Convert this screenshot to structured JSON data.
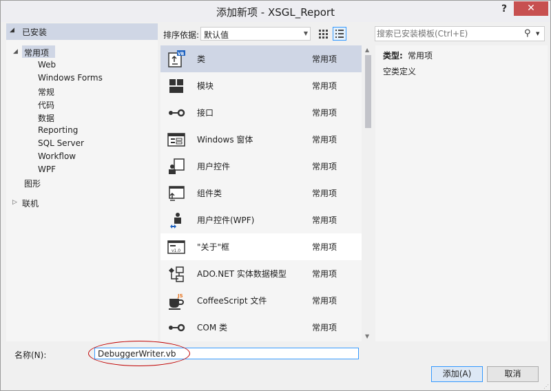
{
  "window": {
    "title": "添加新项 - XSGL_Report",
    "help": "?",
    "close": "✕"
  },
  "tree": {
    "header": "已安装",
    "root": "常用项",
    "children": [
      "Web",
      "Windows Forms",
      "常规",
      "代码",
      "数据",
      "Reporting",
      "SQL Server",
      "Workflow",
      "WPF"
    ],
    "graphics": "图形",
    "online": "联机"
  },
  "toolbar": {
    "sort_label": "排序依据:",
    "sort_value": "默认值",
    "search_placeholder": "搜索已安装模板(Ctrl+E)"
  },
  "items": [
    {
      "name": "类",
      "category": "常用项",
      "icon": "class-icon"
    },
    {
      "name": "模块",
      "category": "常用项",
      "icon": "module-icon"
    },
    {
      "name": "接口",
      "category": "常用项",
      "icon": "interface-icon"
    },
    {
      "name": "Windows 窗体",
      "category": "常用项",
      "icon": "windows-form-icon"
    },
    {
      "name": "用户控件",
      "category": "常用项",
      "icon": "user-control-icon"
    },
    {
      "name": "组件类",
      "category": "常用项",
      "icon": "component-class-icon"
    },
    {
      "name": "用户控件(WPF)",
      "category": "常用项",
      "icon": "wpf-user-control-icon"
    },
    {
      "name": "\"关于\"框",
      "category": "常用项",
      "icon": "about-box-icon"
    },
    {
      "name": "ADO.NET 实体数据模型",
      "category": "常用项",
      "icon": "entity-data-model-icon"
    },
    {
      "name": "CoffeeScript 文件",
      "category": "常用项",
      "icon": "coffeescript-icon"
    },
    {
      "name": "COM 类",
      "category": "常用项",
      "icon": "com-class-icon"
    }
  ],
  "details": {
    "type_key": "类型:",
    "type_value": "常用项",
    "description": "空类定义"
  },
  "bottom": {
    "name_label": "名称(N):",
    "name_value": "DebuggerWriter.vb",
    "add_button": "添加(A)",
    "cancel_button": "取消"
  },
  "colors": {
    "selection": "#cfd6e5",
    "accent": "#3399ff",
    "close": "#c75050",
    "annotation": "#c00000"
  }
}
